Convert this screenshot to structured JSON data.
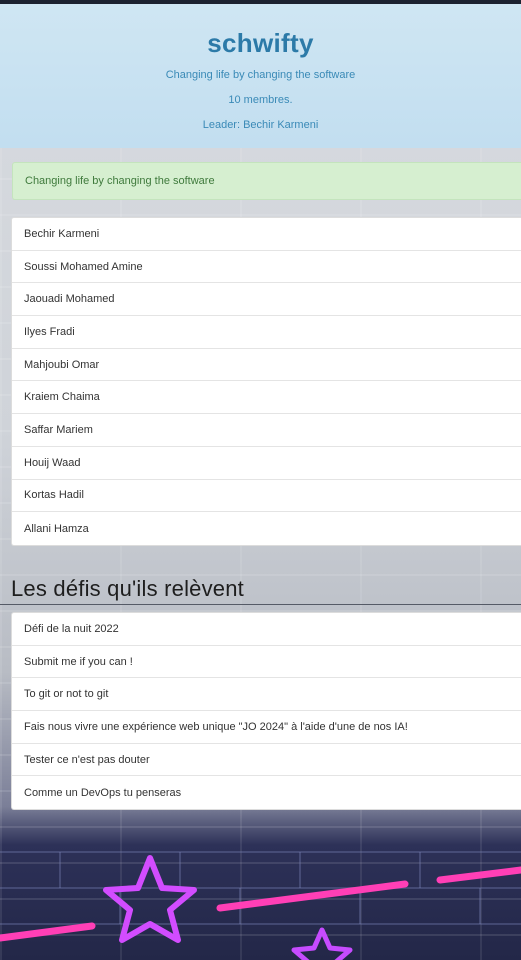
{
  "team": {
    "name": "schwifty",
    "tagline": "Changing life by changing the software",
    "members_count": "10 membres.",
    "leader": "Leader: Bechir Karmeni"
  },
  "alert": {
    "text": "Changing life by changing the software"
  },
  "members": [
    "Bechir Karmeni",
    "Soussi Mohamed Amine",
    "Jaouadi Mohamed",
    "Ilyes Fradi",
    "Mahjoubi Omar",
    "Kraiem Chaima",
    "Saffar Mariem",
    "Houij Waad",
    "Kortas Hadil",
    "Allani Hamza"
  ],
  "defis": {
    "title": "Les défis qu'ils relèvent",
    "items": [
      "Défi de la nuit 2022",
      "Submit me if you can !",
      "To git or not to git",
      "Fais nous vivre une expérience web unique \"JO 2024\" à l'aide d'une de nos IA!",
      "Tester ce n'est pas douter",
      "Comme un DevOps tu penseras"
    ]
  },
  "colors": {
    "title": "#2c7aa8",
    "header_bg": "#c2def0",
    "alert_bg": "#d6efd0",
    "alert_text": "#3f7a3c"
  }
}
